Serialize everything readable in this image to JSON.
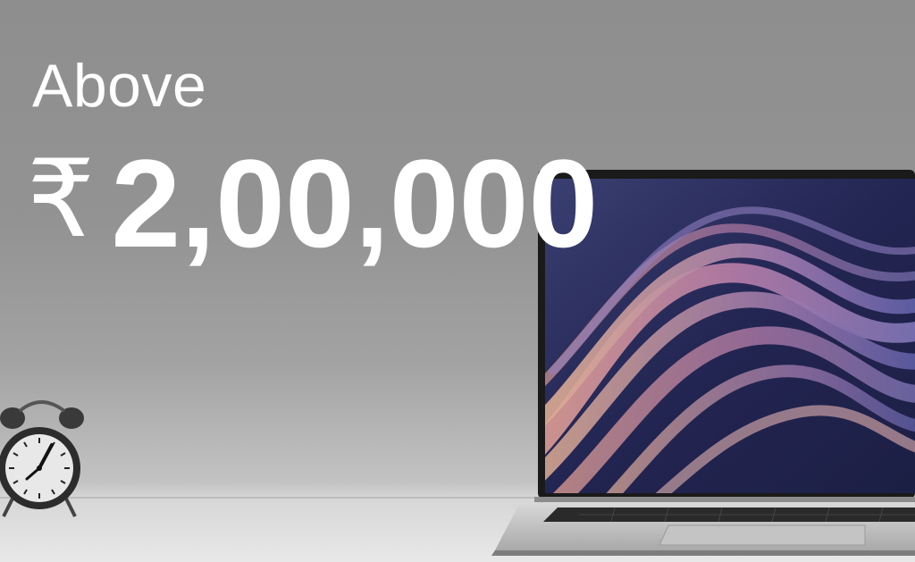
{
  "banner": {
    "line1": "Above",
    "currency_symbol": "₹",
    "amount": "2,00,000"
  },
  "colors": {
    "background": "#8f8f8f",
    "text": "#ffffff"
  },
  "images": {
    "laptop": "laptop-with-wave-wallpaper",
    "clock": "alarm-clock"
  }
}
